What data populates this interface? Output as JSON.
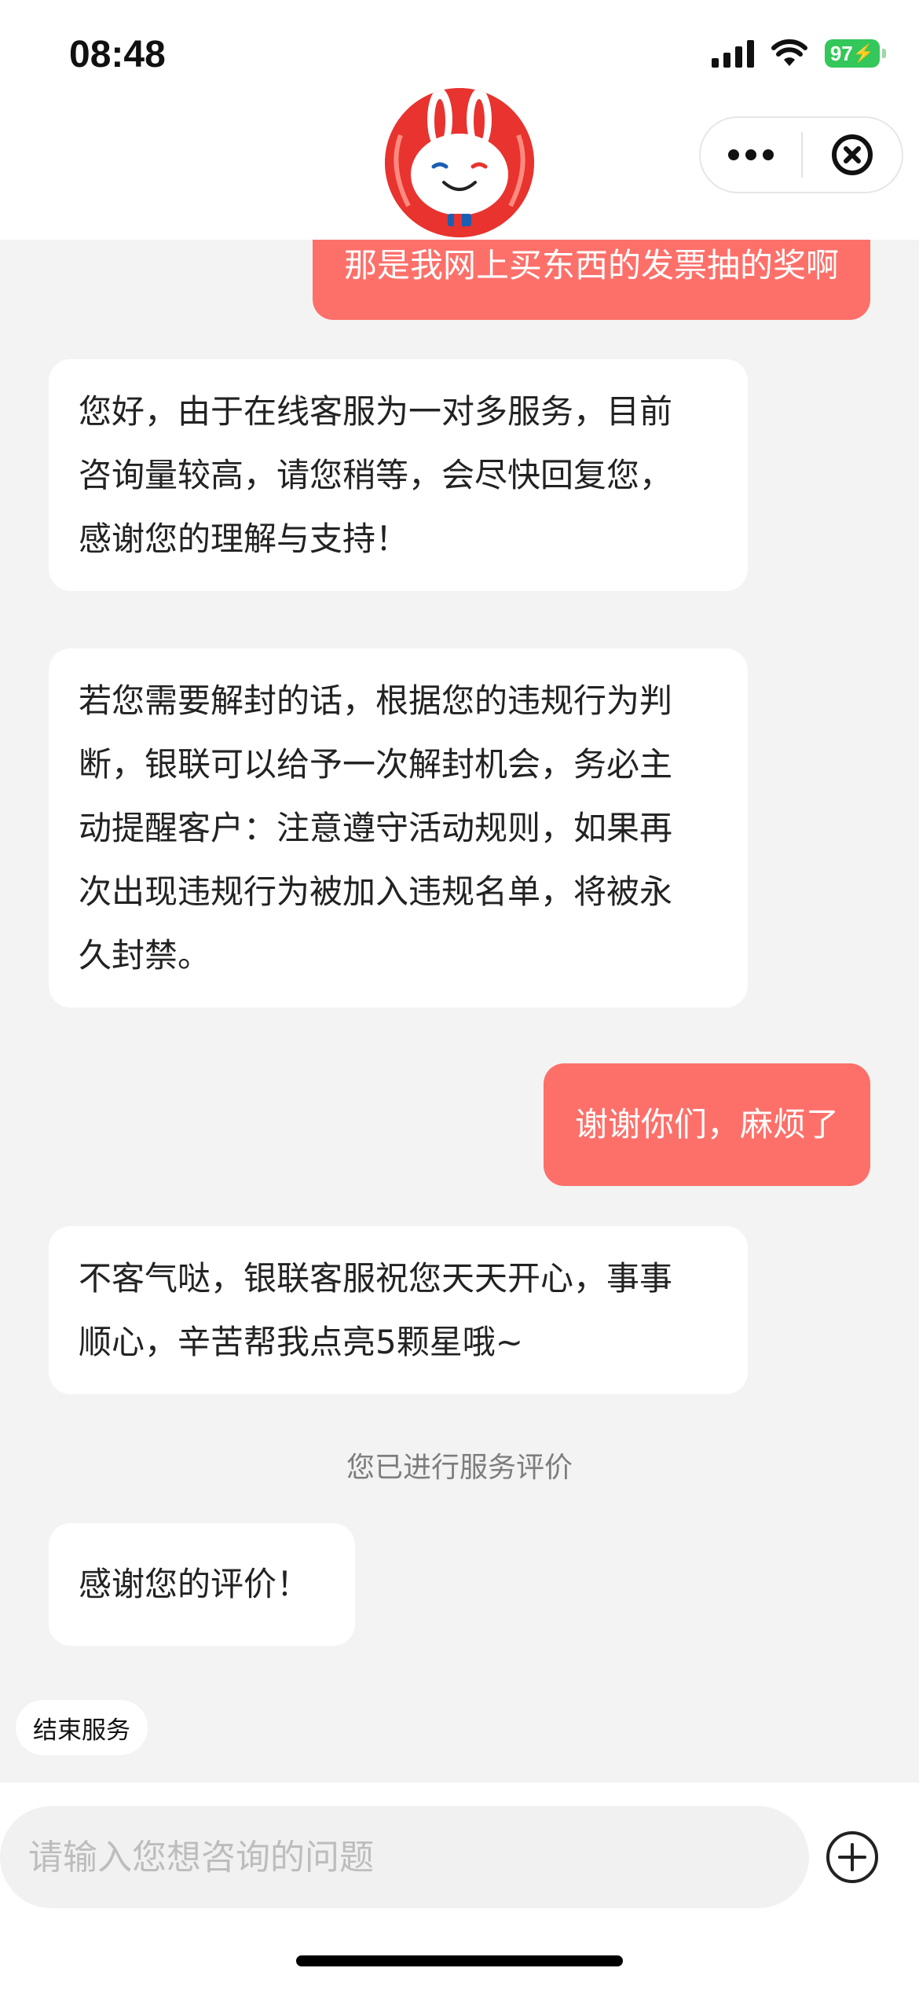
{
  "status_bar": {
    "time": "08:48",
    "battery": "97"
  },
  "header": {
    "avatar_icon": "unionpay-rabbit-mascot",
    "more_icon": "ellipsis-icon",
    "close_icon": "close-circle-icon"
  },
  "messages": [
    {
      "from": "user",
      "text": "那是我网上买东西的发票抽的奖啊"
    },
    {
      "from": "agent",
      "lines": [
        "您好，由于在线客服为一对多服务，目前",
        "咨询量较高，请您稍等，会尽快回复您，",
        "感谢您的理解与支持！"
      ]
    },
    {
      "from": "agent",
      "lines": [
        "若您需要解封的话，根据您的违规行为判",
        "断，银联可以给予一次解封机会，务必主",
        "动提醒客户：注意遵守活动规则，如果再",
        "次出现违规行为被加入违规名单，将被永",
        "久封禁。"
      ]
    },
    {
      "from": "user",
      "text": "谢谢你们，麻烦了"
    },
    {
      "from": "agent",
      "lines": [
        "不客气哒，银联客服祝您天天开心，事事",
        "顺心，辛苦帮我点亮5颗星哦~"
      ]
    },
    {
      "from": "agent",
      "lines": [
        "感谢您的评价！"
      ]
    }
  ],
  "notice": "您已进行服务评价",
  "end_service_label": "结束服务",
  "input": {
    "placeholder": "请输入您想咨询的问题",
    "value": ""
  },
  "colors": {
    "user_bubble": "#fd706a",
    "battery": "#34c759",
    "brand_red": "#e8332f"
  }
}
